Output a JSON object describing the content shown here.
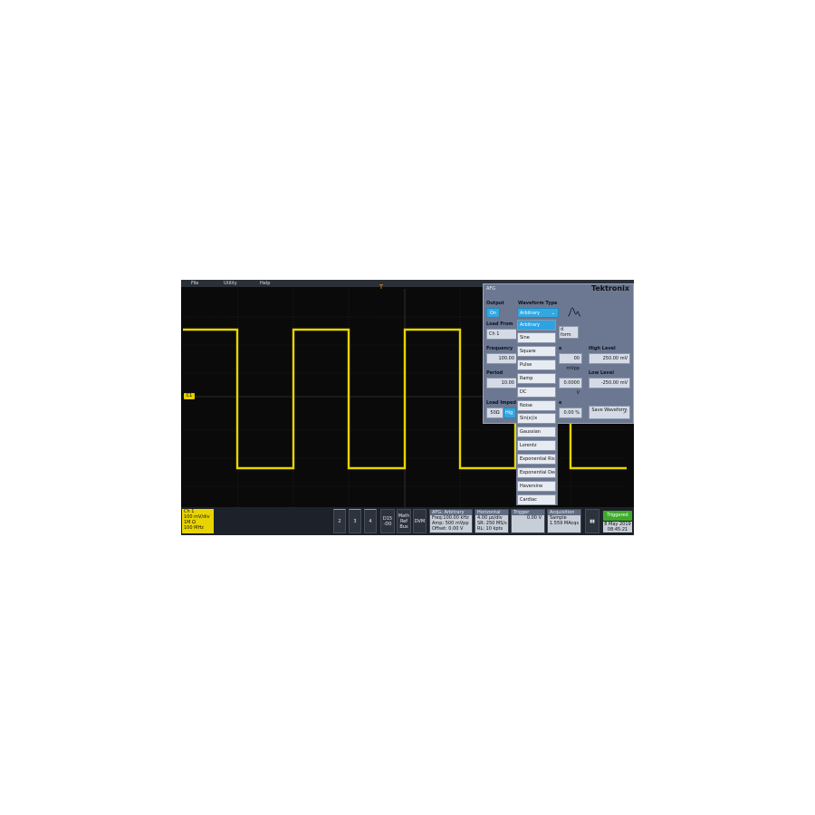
{
  "menubar": {
    "file": "File",
    "utility": "Utility",
    "help": "Help"
  },
  "channel_badge": "C1",
  "trigger_marker": "T",
  "afg_panel": {
    "title": "AFG",
    "logo": "Tektronix",
    "output_label": "Output",
    "output_value": "On",
    "waveform_type_label": "Waveform Type",
    "waveform_type_value": "Arbitrary",
    "load_from_label": "Load From",
    "load_from_value": "Ch 1",
    "waveform_label_partial": "d\nform",
    "frequency_label": "Frequency",
    "frequency_value": "100.00",
    "amplitude_value": "00 mVpp",
    "high_level_label": "High Level",
    "high_level_value": "250.00 mV",
    "period_label": "Period",
    "period_value": "10.00",
    "offset_value": "0.0000 V",
    "low_level_label": "Low Level",
    "low_level_value": "-250.00 mV",
    "load_impedance_label": "Load Impedi",
    "load_impedance_50": "50Ω",
    "load_impedance_high": "Hig",
    "extra_value": "0.00 %",
    "save_waveform": "Save Waveform"
  },
  "waveform_dropdown": [
    "Arbitrary",
    "Sine",
    "Square",
    "Pulse",
    "Ramp",
    "DC",
    "Noise",
    "Sin(x)/x",
    "Gaussian",
    "Lorentz",
    "Exponential Rise",
    "Exponential Deca",
    "Haversine",
    "Cardiac"
  ],
  "status_bar": {
    "ch1": [
      "Ch 1",
      "100 mV/div",
      "1M Ω",
      "100 MHz"
    ],
    "ch2": "2",
    "ch3": "3",
    "ch4": "4",
    "d15": "D15\n-D0",
    "math": "Math\nRef\nBus",
    "dvm": "DVM",
    "afg": {
      "head": "AFG: Arbitrary",
      "l1": "Freq:100.00 kHz",
      "l2": "Amp: 500 mVpp",
      "l3": "Offset: 0.00 V"
    },
    "horizontal": {
      "head": "Horizontal",
      "l1": "4.00 µs/div",
      "l2": "SR: 250 MS/s",
      "l3": "RL: 10 kpts"
    },
    "trigger": {
      "head": "Trigger",
      "l1": "0.00 V"
    },
    "acquisition": {
      "head": "Acquisition",
      "l1": "Sample",
      "l2": "1.559 MAcqs"
    },
    "triggered": "Triggered",
    "date": "8 May 2019",
    "time": "08:45:21"
  },
  "colors": {
    "trace": "#e8d400",
    "afg_panel": "#6c7891",
    "highlight": "#2da3e3",
    "triggered": "#3faa2a"
  }
}
